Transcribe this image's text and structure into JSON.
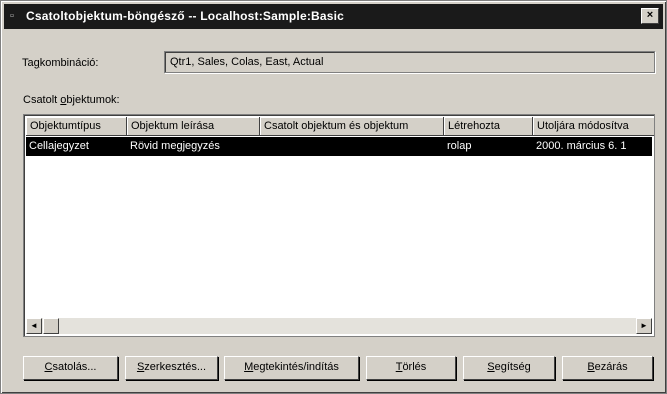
{
  "window": {
    "title": "Csatoltobjektum-böngésző -- Localhost:Sample:Basic",
    "close_glyph": "×"
  },
  "member_combo": {
    "label_pre": "Ta",
    "label_key": "g",
    "label_post": "kombináció:",
    "value": "Qtr1, Sales, Colas, East, Actual"
  },
  "linked_objects": {
    "label_pre": "Csatolt ",
    "label_key": "o",
    "label_post": "bjektumok:"
  },
  "table": {
    "columns": [
      "Objektumtípus",
      "Objektum leírása",
      "Csatolt objektum és objektum",
      "Létrehozta",
      "Utoljára módosítva"
    ],
    "rows": [
      [
        "Cellajegyzet",
        "Rövid megjegyzés",
        "",
        "rolap",
        "2000. március 6. 1"
      ]
    ]
  },
  "scrollbar": {
    "left_arrow": "◄",
    "right_arrow": "►"
  },
  "buttons": [
    {
      "key": "C",
      "rest": "satolás..."
    },
    {
      "key": "S",
      "rest": "zerkesztés..."
    },
    {
      "key": "M",
      "rest": "egtekintés/indítás"
    },
    {
      "key": "T",
      "rest": "örlés"
    },
    {
      "key": "S",
      "rest": "egítség"
    },
    {
      "key": "B",
      "rest": "ezárás"
    }
  ]
}
